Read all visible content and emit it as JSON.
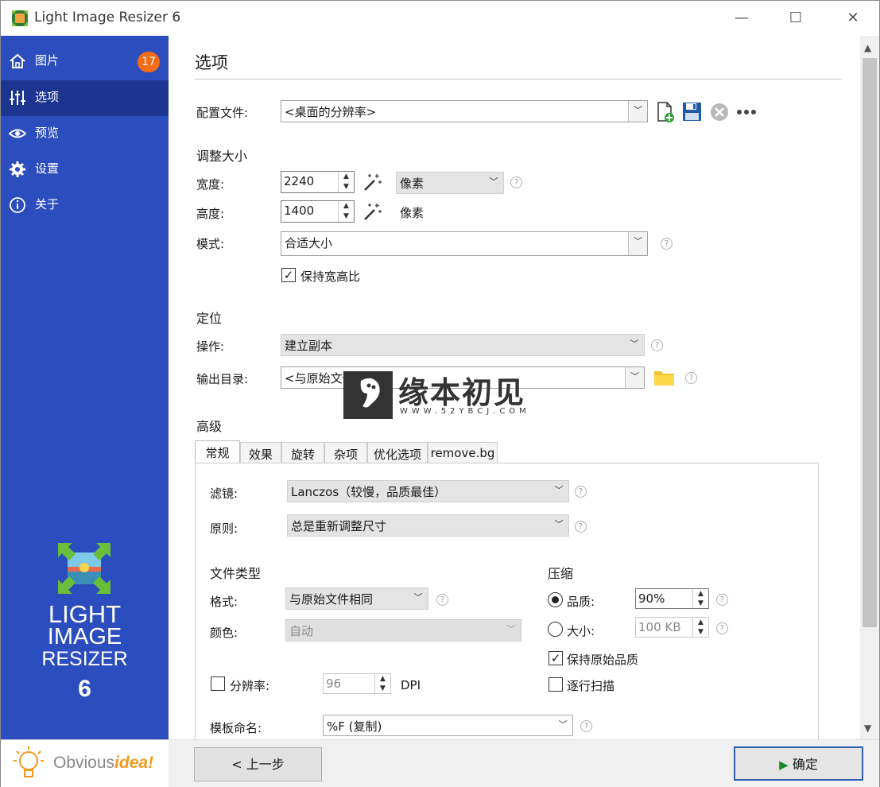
{
  "window": {
    "title": "Light Image Resizer 6",
    "minimize": "—",
    "maximize": "☐",
    "close": "✕"
  },
  "sidebar": {
    "items": [
      {
        "label": "图片",
        "icon": "home-icon",
        "badge": "17"
      },
      {
        "label": "选项",
        "icon": "sliders-icon"
      },
      {
        "label": "预览",
        "icon": "eye-icon"
      },
      {
        "label": "设置",
        "icon": "gear-icon"
      },
      {
        "label": "关于",
        "icon": "info-icon"
      }
    ],
    "active_index": 1,
    "logo_lines": [
      "LIGHT",
      "IMAGE",
      "RESIZER",
      "6"
    ],
    "brand_plain": "Obvious",
    "brand_accent": "idea!"
  },
  "main": {
    "title": "选项",
    "profile": {
      "label": "配置文件:",
      "value": "<桌面的分辨率>"
    },
    "resize": {
      "section": "调整大小",
      "width_label": "宽度:",
      "width_value": "2240",
      "width_unit": "像素",
      "height_label": "高度:",
      "height_value": "1400",
      "height_unit": "像素",
      "mode_label": "模式:",
      "mode_value": "合适大小",
      "keep_ratio_label": "保持宽高比",
      "keep_ratio_checked": true
    },
    "target": {
      "section": "定位",
      "action_label": "操作:",
      "action_value": "建立副本",
      "output_label": "输出目录:",
      "output_value": "<与原始文件相同>"
    },
    "advanced": {
      "section": "高级",
      "tabs": [
        "常规",
        "效果",
        "旋转",
        "杂项",
        "优化选项",
        "remove.bg"
      ],
      "active_tab": 0,
      "filter_label": "滤镜:",
      "filter_value": "Lanczos（较慢，品质最佳）",
      "rule_label": "原则:",
      "rule_value": "总是重新调整尺寸",
      "filetype_section": "文件类型",
      "format_label": "格式:",
      "format_value": "与原始文件相同",
      "color_label": "颜色:",
      "color_value": "自动",
      "resolution_label": "分辨率:",
      "resolution_value": "96",
      "resolution_unit": "DPI",
      "resolution_checked": false,
      "compress_section": "压缩",
      "quality_label": "品质:",
      "quality_value": "90%",
      "quality_selected": true,
      "size_label": "大小:",
      "size_value": "100 KB",
      "keep_quality_label": "保持原始品质",
      "keep_quality_checked": true,
      "progressive_label": "逐行扫描",
      "progressive_checked": false,
      "naming_label": "模板命名:",
      "naming_value": "%F (复制)"
    }
  },
  "footer": {
    "back_label": "< 上一步",
    "ok_label": "确定"
  },
  "watermark": {
    "text": "缘本初见",
    "url": "WWW.52YBCJ.COM"
  }
}
